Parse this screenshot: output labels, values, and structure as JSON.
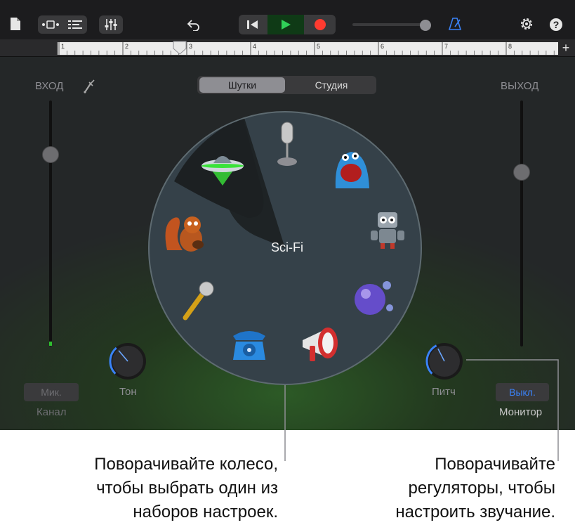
{
  "toolbar": {
    "icons": [
      "document-icon",
      "view-toggle-icon",
      "tracks-icon",
      "mixer-icon",
      "undo-icon",
      "rewind-icon",
      "play-icon",
      "record-icon",
      "volume-slider",
      "metronome-icon",
      "settings-icon",
      "help-icon"
    ]
  },
  "ruler": {
    "marks": [
      "1",
      "2",
      "3",
      "4",
      "5",
      "6",
      "7",
      "8"
    ],
    "add_label": "+"
  },
  "segmented": {
    "options": [
      "Шутки",
      "Студия"
    ],
    "selected": "Шутки"
  },
  "input": {
    "label": "ВХОД",
    "level": 0.78
  },
  "output": {
    "label": "ВЫХОД",
    "level": 0.71
  },
  "wheel": {
    "current": "Sci-Fi",
    "presets": [
      "ufo-icon",
      "microphone-icon",
      "monster-icon",
      "robot-icon",
      "bubbles-icon",
      "megaphone-icon",
      "telephone-icon",
      "gold-microphone-icon",
      "squirrel-icon"
    ]
  },
  "knobs": {
    "tone_label": "Тон",
    "pitch_label": "Питч",
    "tone_value": 0.35,
    "pitch_value": 0.4
  },
  "channel": {
    "mic_label": "Мик.",
    "channel_label": "Канал"
  },
  "monitor": {
    "toggle_label": "Выкл.",
    "monitor_label": "Монитор"
  },
  "callouts": {
    "wheel_line1": "Поворачивайте колесо,",
    "wheel_line2": "чтобы выбрать один из",
    "wheel_line3": "наборов настроек.",
    "knob_line1": "Поворачивайте",
    "knob_line2": "регуляторы, чтобы",
    "knob_line3": "настроить звучание."
  },
  "colors": {
    "accent": "#3a82f7",
    "play": "#30d158",
    "record": "#ff3b30",
    "ufo_glow": "#39e339"
  }
}
